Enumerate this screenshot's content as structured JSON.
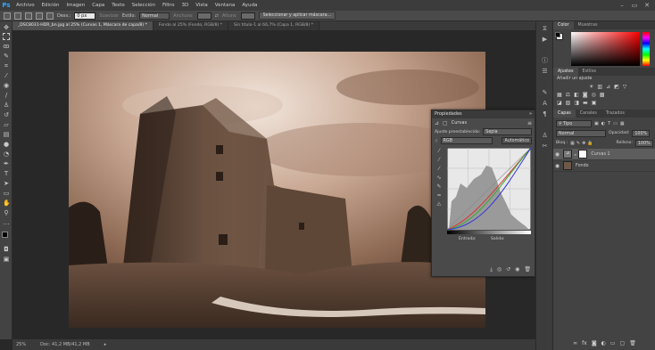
{
  "app": {
    "logo": "Ps"
  },
  "menu": [
    "Archivo",
    "Edición",
    "Imagen",
    "Capa",
    "Texto",
    "Selección",
    "Filtro",
    "3D",
    "Vista",
    "Ventana",
    "Ayuda"
  ],
  "window_controls": [
    "–",
    "▭",
    "✕"
  ],
  "options": {
    "desvan_label": "Desv.:",
    "desvan_value": "0 px",
    "suavizar_label": "Suavizar",
    "estilo_label": "Estilo:",
    "estilo_value": "Normal",
    "anchura_label": "Anchura:",
    "altura_label": "Altura:",
    "select_mask_button": "Seleccionar y aplicar máscara..."
  },
  "tabs": [
    {
      "label": "_DSC8031-HDR_bn.jpg al 25% (Curvas 1, Máscara de capa/8) *",
      "active": true
    },
    {
      "label": "Fondo al 25% (Fondo, RGB/8) *",
      "active": false
    },
    {
      "label": "Sin título-1 al 66,7% (Capa 1, RGB/8) *",
      "active": false
    }
  ],
  "status": {
    "zoom": "25%",
    "doc": "Doc: 41,2 MB/41,2 MB"
  },
  "right": {
    "top_tabs": [
      {
        "label": "Color",
        "active": true
      },
      {
        "label": "Muestras",
        "active": false
      }
    ],
    "adjust_tabs": [
      {
        "label": "Ajustes",
        "active": true
      },
      {
        "label": "Estilos",
        "active": false
      }
    ],
    "adjust_heading": "Añadir un ajuste",
    "layer_tabs": [
      {
        "label": "Capas",
        "active": true
      },
      {
        "label": "Canales",
        "active": false
      },
      {
        "label": "Trazados",
        "active": false
      }
    ],
    "filter_label": "Tipo",
    "blend_mode": "Normal",
    "opacity_label": "Opacidad:",
    "opacity_value": "100%",
    "lock_label": "Bloq.:",
    "fill_label": "Relleno:",
    "fill_value": "100%",
    "layers": [
      {
        "name": "Curvas 1",
        "selected": true
      },
      {
        "name": "Fondo",
        "selected": false
      }
    ]
  },
  "properties": {
    "title": "Propiedades",
    "close": "»",
    "menu": "≡",
    "panel_name": "Curvas",
    "preset_label": "Ajuste preestablecido:",
    "preset_value": "Sepia",
    "channel": "RGB",
    "auto": "Automático",
    "input_label": "Entrada:",
    "output_label": "Salida:"
  },
  "colors": {
    "accent": "#31a8ff",
    "background": "#282828",
    "panel": "#434343"
  }
}
